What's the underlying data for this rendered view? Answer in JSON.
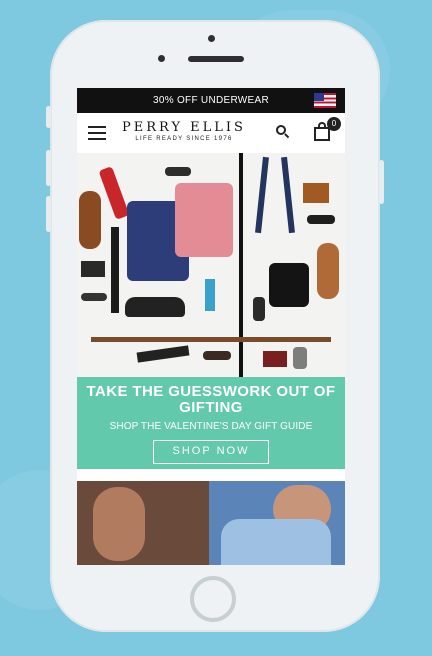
{
  "promo_bar": {
    "text": "30% OFF UNDERWEAR",
    "flag_icon": "us-flag-icon"
  },
  "header": {
    "menu_icon": "hamburger-menu-icon",
    "brand": "PERRY ELLIS",
    "tagline": "LIFE READY SINCE 1976",
    "search_icon": "search-icon",
    "cart_icon": "shopping-bag-icon",
    "cart_count": "0"
  },
  "hero": {
    "headline": "TAKE THE GUESSWORK OUT OF GIFTING",
    "subhead": "SHOP THE VALENTINE'S DAY GIFT GUIDE",
    "button_label": "SHOP NOW"
  },
  "colors": {
    "background": "#7ec8e0",
    "promo_bar": "#111111",
    "cta_teal": "#62c9ad"
  }
}
